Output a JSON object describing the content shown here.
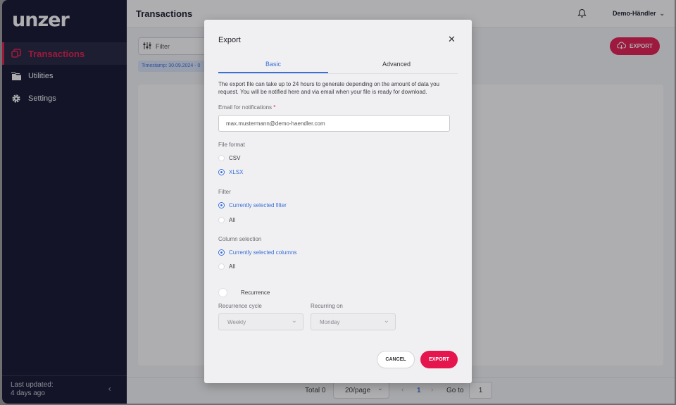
{
  "brand": {
    "logo_text": "unzer",
    "accent": "#e5164e",
    "navy": "#0d0f2b",
    "link_blue": "#3a6fd8"
  },
  "sidebar": {
    "items": [
      {
        "label": "Transactions",
        "icon": "transactions-icon",
        "active": true
      },
      {
        "label": "Utilities",
        "icon": "folder-icon",
        "active": false
      },
      {
        "label": "Settings",
        "icon": "gear-icon",
        "active": false
      }
    ],
    "footer": {
      "line1": "Last updated:",
      "line2": "4 days ago",
      "collapse_icon": "chevron-left-icon"
    }
  },
  "header": {
    "title": "Transactions",
    "user": "Demo-Händler",
    "bell_icon": "bell-icon"
  },
  "toolbar": {
    "filter_placeholder": "Filter",
    "filter_chip": "Timestamp: 30.09.2024 - 0",
    "export_label": "EXPORT"
  },
  "pagination": {
    "total": "Total 0",
    "page_size": "20/page",
    "current_page": "1",
    "goto_label": "Go to",
    "goto_value": "1"
  },
  "modal": {
    "title": "Export",
    "tabs": [
      {
        "label": "Basic",
        "active": true
      },
      {
        "label": "Advanced",
        "active": false
      }
    ],
    "description": "The export file can take up to 24 hours to generate depending on the amount of data you request. You will be notified here and via email when your file is ready for download.",
    "email": {
      "label": "Email for notifications",
      "required_mark": "*",
      "value": "max.mustermann@demo-haendler.com"
    },
    "file_format": {
      "label": "File format",
      "options": [
        "CSV",
        "XLSX"
      ],
      "selected": "XLSX"
    },
    "filter": {
      "label": "Filter",
      "options": [
        "Currently selected filter",
        "All"
      ],
      "selected": "Currently selected filter"
    },
    "column_selection": {
      "label": "Column selection",
      "options": [
        "Currently selected columns",
        "All"
      ],
      "selected": "Currently selected columns"
    },
    "recurrence": {
      "label": "Recurrence",
      "enabled": false,
      "cycle_label": "Recurrence cycle",
      "cycle_value": "Weekly",
      "on_label": "Recurring on",
      "on_value": "Monday"
    },
    "cancel_label": "CANCEL",
    "export_label": "EXPORT"
  }
}
